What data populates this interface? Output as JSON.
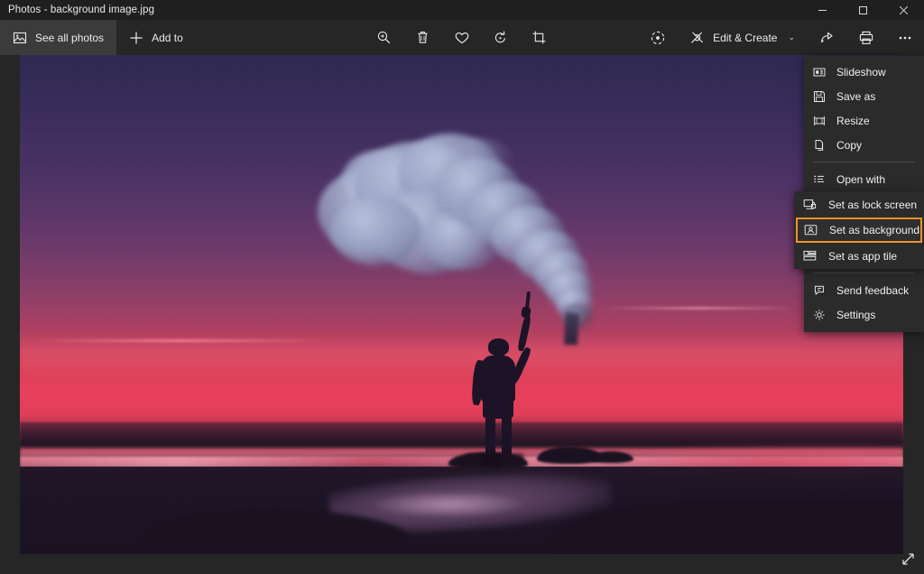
{
  "window": {
    "title": "Photos - background image.jpg",
    "controls": [
      {
        "name": "minimize",
        "glyph": "minimize-icon"
      },
      {
        "name": "maximize",
        "glyph": "maximize-icon"
      },
      {
        "name": "close",
        "glyph": "close-icon"
      }
    ]
  },
  "toolbar": {
    "left": [
      {
        "label": "See all photos",
        "icon": "photos-icon",
        "active": true
      },
      {
        "label": "Add to",
        "icon": "plus-icon",
        "active": false
      }
    ],
    "center": [
      {
        "name": "zoom-icon",
        "tooltip": "Zoom"
      },
      {
        "name": "delete-icon",
        "tooltip": "Delete"
      },
      {
        "name": "heart-icon",
        "tooltip": "Add to favorites"
      },
      {
        "name": "rotate-icon",
        "tooltip": "Rotate"
      },
      {
        "name": "crop-icon",
        "tooltip": "Crop and rotate"
      }
    ],
    "right": {
      "enhance_icon": "enhance-icon",
      "edit_create_label": "Edit & Create",
      "edit_create_icon": "edit-create-icon",
      "edit_create_caret": "⌄",
      "share_icon": "share-icon",
      "print_icon": "print-icon",
      "more_icon": "more-ellipsis-icon"
    }
  },
  "menu": {
    "items": [
      {
        "label": "Slideshow",
        "icon": "slideshow-icon"
      },
      {
        "label": "Save as",
        "icon": "save-icon"
      },
      {
        "label": "Resize",
        "icon": "resize-icon"
      },
      {
        "label": "Copy",
        "icon": "copy-icon"
      },
      {
        "separator_after": true
      },
      {
        "label": "Open with",
        "icon": "open-with-icon"
      },
      {
        "separator_after": true
      },
      {
        "label": "Send feedback",
        "icon": "feedback-icon"
      },
      {
        "label": "Settings",
        "icon": "settings-gear-icon"
      }
    ],
    "slideshow": "Slideshow",
    "save_as": "Save as",
    "resize": "Resize",
    "copy": "Copy",
    "open_with": "Open with",
    "send_feedback": "Send feedback",
    "settings": "Settings"
  },
  "submenu": {
    "set_as_lock_screen": "Set as lock screen",
    "set_as_background": "Set as background",
    "set_as_app_tile": "Set as app tile",
    "highlighted": "Set as background",
    "highlight_color": "#f0922b"
  },
  "canvas": {
    "resize_handle_icon": "resize-diagonal-icon",
    "image_description": "Silhouette of a person on a beach at sunset holding a smoke flare, dark purple to pink sky gradient with a large blue-grey smoke plume"
  },
  "colors": {
    "titlebar_bg": "#1f1f1f",
    "toolbar_bg": "#262626",
    "menu_bg": "#2b2b2b",
    "accent_highlight": "#f0922b",
    "text": "#f0f0f0",
    "sky_top": "#2e2a52",
    "sky_mid": "#8d3f68",
    "sky_bottom": "#e8405c",
    "foreground": "#1d1526"
  }
}
